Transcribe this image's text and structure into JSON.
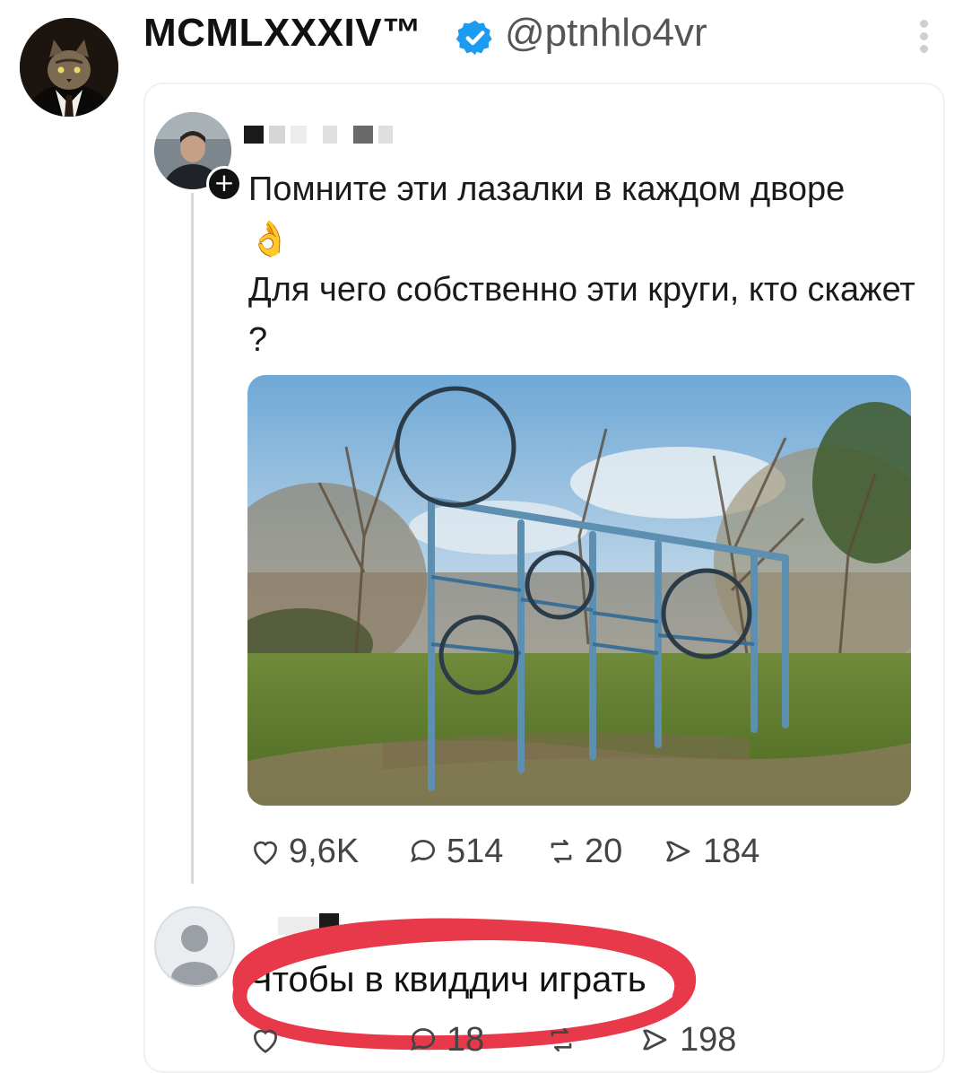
{
  "post": {
    "display_name": "MCMLXXXIV™",
    "handle": "@ptnhlo4vr",
    "verified_icon": "verified-badge-icon",
    "more_icon": "more-vertical-icon"
  },
  "quoted_tweet": {
    "text_line1": "Помните эти лазалки в каждом дворе",
    "emoji": "👌",
    "text_line2": "Для чего собственно эти круги, кто скажет ?",
    "image_alt_icon": "playground-photo",
    "stats": {
      "likes": "9,6K",
      "replies": "514",
      "reposts": "20",
      "views": "184"
    }
  },
  "reply": {
    "text": "Чтобы в квиддич играть",
    "stats": {
      "replies": "18",
      "views": "198"
    },
    "highlight_color": "#e8394b"
  },
  "colors": {
    "accent": "#1d9bf0",
    "text": "#111111",
    "muted": "#555555",
    "highlight": "#e8394b"
  }
}
